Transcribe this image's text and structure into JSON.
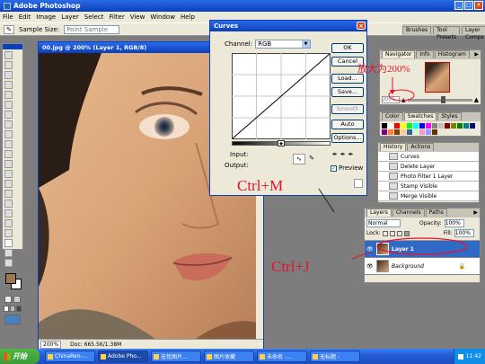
{
  "window": {
    "title": "Adobe Photoshop",
    "controls": [
      "_",
      "□",
      "×"
    ]
  },
  "menu": [
    "File",
    "Edit",
    "Image",
    "Layer",
    "Select",
    "Filter",
    "View",
    "Window",
    "Help"
  ],
  "options": {
    "sample_size_label": "Sample Size:",
    "sample_size_value": "Point Sample"
  },
  "palette_well": [
    "Brushes",
    "Tool Presets",
    "Layer Comps"
  ],
  "document": {
    "title": "00.jpg @ 200% (Layer 1, RGB/8)",
    "zoom": "200%",
    "doc_info": "Doc: 665.5K/1.38M"
  },
  "curves": {
    "title": "Curves",
    "channel_label": "Channel:",
    "channel_value": "RGB",
    "input_label": "Input:",
    "output_label": "Output:",
    "buttons": [
      "OK",
      "Cancel",
      "Load...",
      "Save...",
      "Smooth",
      "Auto",
      "Options..."
    ],
    "preview_label": "Preview",
    "preview_checked": true
  },
  "navigator": {
    "tabs": [
      "Navigator",
      "Info",
      "Histogram"
    ],
    "zoom": "200%"
  },
  "swatches": {
    "tabs": [
      "Color",
      "Swatches",
      "Styles"
    ],
    "colors": [
      "#000000",
      "#ffffff",
      "#ff0000",
      "#ffff00",
      "#00ff00",
      "#00ffff",
      "#0000ff",
      "#ff00ff",
      "#808080",
      "#c0c0c0",
      "#800000",
      "#808000",
      "#008000",
      "#008080",
      "#000080",
      "#800080",
      "#ff8040",
      "#804000",
      "#ffcc99",
      "#336699",
      "#ccffcc",
      "#ff99cc",
      "#9999ff",
      "#663300"
    ]
  },
  "history": {
    "tabs": [
      "History",
      "Actions"
    ],
    "items": [
      "Curves",
      "Delete Layer",
      "Photo Filter 1 Layer",
      "Stamp Visible",
      "Merge Visible"
    ]
  },
  "layers": {
    "tabs": [
      "Layers",
      "Channels",
      "Paths"
    ],
    "blend_mode": "Normal",
    "opacity_label": "Opacity:",
    "opacity_value": "100%",
    "lock_label": "Lock:",
    "fill_label": "Fill:",
    "fill_value": "100%",
    "items": [
      {
        "name": "Layer 1",
        "selected": true
      },
      {
        "name": "Background",
        "selected": false
      }
    ]
  },
  "annotations": {
    "zoom_note": "放大为200%",
    "shortcut_m": "Ctrl+M",
    "shortcut_j": "Ctrl+J"
  },
  "taskbar": {
    "start": "开始",
    "tasks": [
      "ChinaRen-...",
      "Adobe Pho...",
      "无忧图片...",
      "图片收藏",
      "未命名 -...",
      "无标题 -"
    ],
    "clock": "11:42"
  },
  "colors": {
    "title_blue": "#0a3fbd",
    "taskbar_blue": "#245edb",
    "start_green": "#3c9b37",
    "annotation_red": "#e8102a",
    "fg_color": "#a0774a"
  }
}
